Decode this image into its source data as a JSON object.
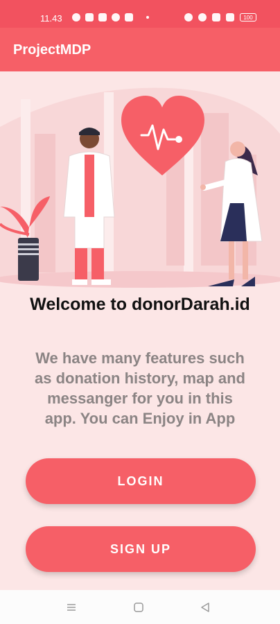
{
  "status_bar": {
    "time": "11.43",
    "battery": "100"
  },
  "app_bar": {
    "title": "ProjectMDP"
  },
  "welcome": {
    "title": "Welcome to donorDarah.id"
  },
  "description": {
    "lines": [
      "We have many features such",
      "as donation history, map and",
      "messanger for you in this",
      "app. You can Enjoy in App"
    ]
  },
  "buttons": {
    "login": "LOGIN",
    "signup": "SIGN UP"
  },
  "colors": {
    "status_bar": "#f2525f",
    "primary": "#f65f67",
    "background": "#fce6e6"
  },
  "nav": {
    "icons": [
      "menu-icon",
      "home-icon",
      "back-icon"
    ]
  }
}
